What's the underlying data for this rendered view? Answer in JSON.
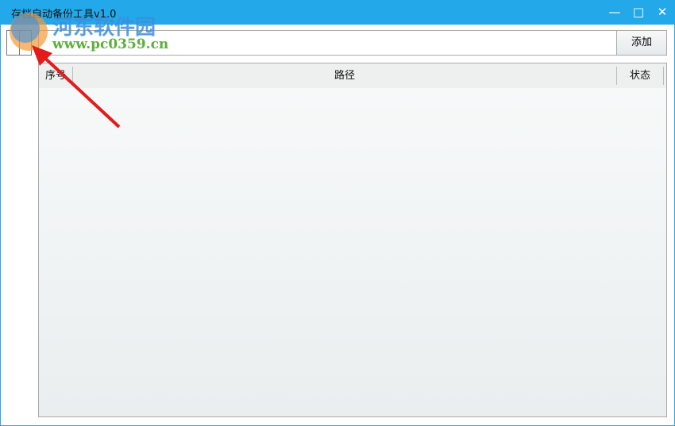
{
  "window": {
    "title": "存档自动备份工具v1.0",
    "minimize": "—",
    "maximize": "□",
    "close": "✕"
  },
  "toolbar": {
    "path_value": "",
    "add_label": "添加"
  },
  "table": {
    "columns": [
      "序号",
      "路径",
      "状态"
    ],
    "rows": []
  },
  "watermark": {
    "name": "河东软件园",
    "url": "www.pc0359.cn"
  }
}
